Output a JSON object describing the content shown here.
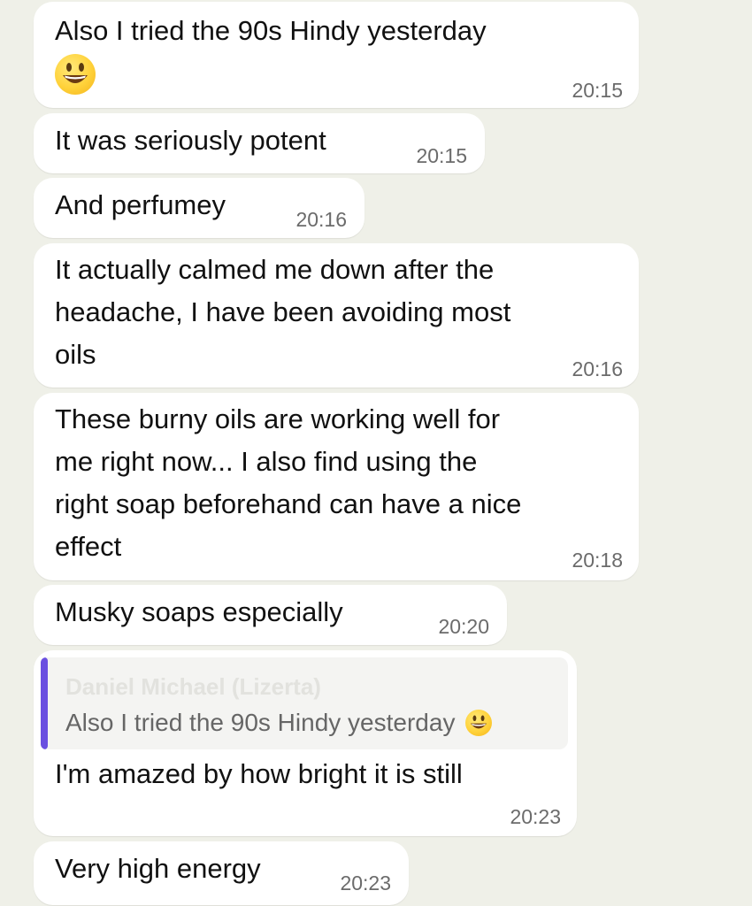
{
  "theme": {
    "background": "#eff0e8",
    "bubble": "#ffffff",
    "quote_accent": "#6a4fe0"
  },
  "messages": [
    {
      "lines": [
        "Also I tried the 90s Hindy yesterday"
      ],
      "emoji": "grinning-face-emoji",
      "time": "20:15"
    },
    {
      "lines": [
        "It was seriously potent"
      ],
      "time": "20:15"
    },
    {
      "lines": [
        "And perfumey"
      ],
      "time": "20:16"
    },
    {
      "lines": [
        "It actually calmed me down after the",
        "headache, I have been avoiding most",
        "oils"
      ],
      "time": "20:16"
    },
    {
      "lines": [
        "These burny oils are working well for",
        "me right now... I also find using the",
        "right soap beforehand can have a nice",
        "effect"
      ],
      "time": "20:18"
    },
    {
      "lines": [
        "Musky soaps especially"
      ],
      "time": "20:20"
    },
    {
      "quote": {
        "author": "Daniel Michael (Lizerta)",
        "text": "Also I tried the 90s Hindy yesterday",
        "emoji": "grinning-face-emoji"
      },
      "lines": [
        "I'm amazed by how bright it is still"
      ],
      "time": "20:23"
    },
    {
      "lines": [
        "Very high energy"
      ],
      "time": "20:23"
    }
  ]
}
